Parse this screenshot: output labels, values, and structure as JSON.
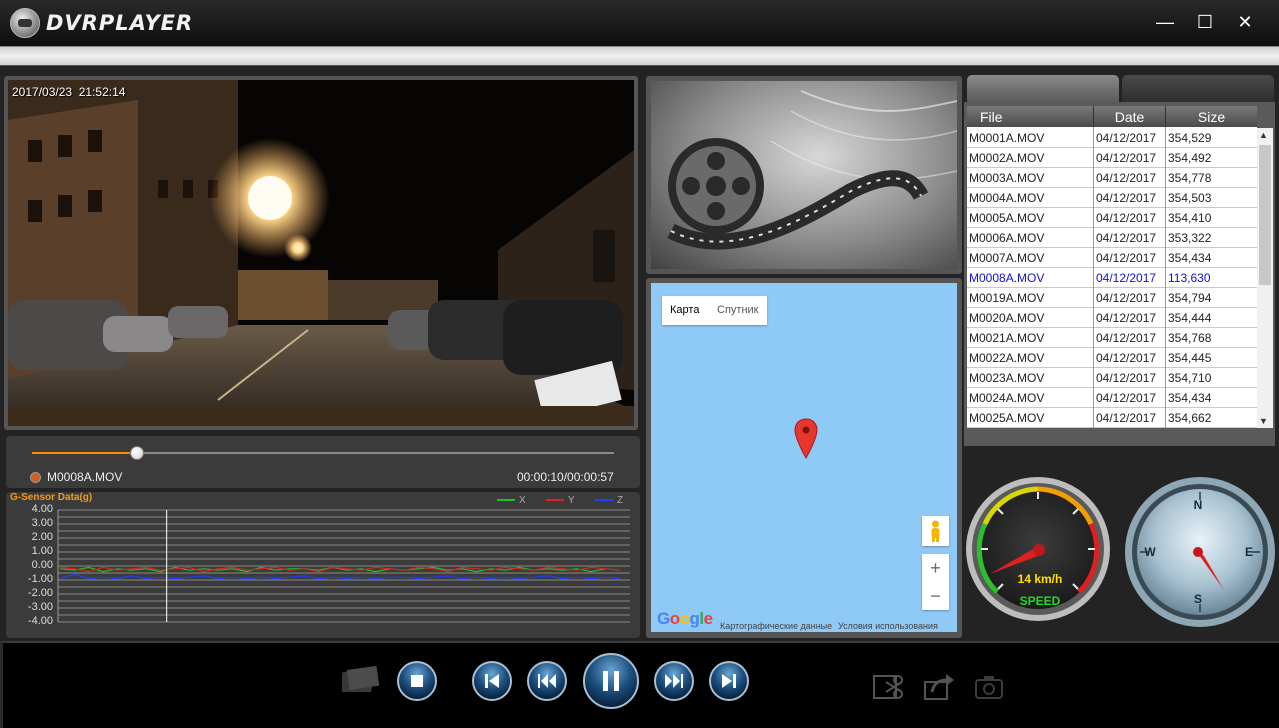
{
  "titlebar": {
    "app_title": "DVRPLAYER",
    "minimize": "—",
    "maximize": "☐",
    "close": "✕"
  },
  "video": {
    "date": "2017/03/23",
    "time": "21:52:14"
  },
  "timeline": {
    "current_file": "M0008A.MOV",
    "elapsed": "00:00:10",
    "duration": "00:00:57",
    "time_readout": "00:00:10/00:00:57",
    "progress": 0.18
  },
  "gsensor": {
    "chart_data": {
      "type": "line",
      "title": "G-Sensor Data(g)",
      "ylim": [
        -4.0,
        4.0
      ],
      "y_ticks": [
        "4.00",
        "3.00",
        "2.00",
        "1.00",
        "0.00",
        "-1.00",
        "-2.00",
        "-3.00",
        "-4.00"
      ],
      "grid": true,
      "legend_position": "top-right",
      "cursor_position": 0.19,
      "series": [
        {
          "name": "X",
          "color": "#1fc21f",
          "values": [
            -0.2,
            -0.3,
            -0.1,
            -0.4,
            -0.2,
            -0.3,
            -0.2,
            -0.4,
            -0.1,
            -0.3,
            -0.2,
            -0.3,
            -0.2,
            -0.4,
            -0.1,
            -0.3,
            -0.2,
            -0.2,
            -0.3,
            -0.1,
            -0.3,
            -0.2,
            -0.4,
            -0.2,
            -0.3,
            -0.2,
            -0.1,
            -0.3,
            -0.2,
            -0.4,
            -0.2,
            -0.3,
            -0.1,
            -0.3,
            -0.2,
            -0.3,
            -0.2,
            -0.4,
            -0.2,
            -0.3
          ]
        },
        {
          "name": "Y",
          "color": "#e02020",
          "values": [
            -0.1,
            -0.2,
            -0.4,
            -0.1,
            -0.3,
            -0.2,
            -0.1,
            -0.3,
            -0.2,
            -0.1,
            -0.4,
            -0.2,
            -0.1,
            -0.3,
            -0.2,
            -0.1,
            -0.3,
            -0.2,
            -0.4,
            -0.1,
            -0.2,
            -0.3,
            -0.1,
            -0.2,
            -0.3,
            -0.1,
            -0.2,
            -0.4,
            -0.1,
            -0.2,
            -0.3,
            -0.1,
            -0.2,
            -0.3,
            -0.1,
            -0.2,
            -0.3,
            -0.1,
            -0.2,
            -0.3
          ]
        },
        {
          "name": "Z",
          "color": "#2040ff",
          "values": [
            -0.9,
            -0.6,
            -0.9,
            -0.8,
            -0.9,
            -0.7,
            -0.9,
            -0.8,
            -0.9,
            -0.8,
            -0.7,
            -0.9,
            -0.8,
            -0.9,
            -0.8,
            -0.9,
            -0.8,
            -0.7,
            -0.9,
            -0.8,
            -0.9,
            -0.8,
            -0.9,
            -0.8,
            -0.8,
            -0.9,
            -0.8,
            -0.7,
            -0.9,
            -0.8,
            -0.9,
            -0.8,
            -0.9,
            -0.8,
            -0.7,
            -0.9,
            -0.8,
            -0.9,
            -0.8,
            -0.9
          ]
        }
      ]
    }
  },
  "map": {
    "map_btn": "Карта",
    "satellite_btn": "Спутник",
    "zoom_in": "+",
    "zoom_out": "−",
    "map_data_text": "Картографические данные",
    "terms_text": "Условия использования"
  },
  "file_list": {
    "columns": [
      "File",
      "Date",
      "Size"
    ],
    "rows": [
      {
        "file": "M0001A.MOV",
        "date": "04/12/2017",
        "size": "354,529"
      },
      {
        "file": "M0002A.MOV",
        "date": "04/12/2017",
        "size": "354,492"
      },
      {
        "file": "M0003A.MOV",
        "date": "04/12/2017",
        "size": "354,778"
      },
      {
        "file": "M0004A.MOV",
        "date": "04/12/2017",
        "size": "354,503"
      },
      {
        "file": "M0005A.MOV",
        "date": "04/12/2017",
        "size": "354,410"
      },
      {
        "file": "M0006A.MOV",
        "date": "04/12/2017",
        "size": "353,322"
      },
      {
        "file": "M0007A.MOV",
        "date": "04/12/2017",
        "size": "354,434"
      },
      {
        "file": "M0008A.MOV",
        "date": "04/12/2017",
        "size": "113,630"
      },
      {
        "file": "M0019A.MOV",
        "date": "04/12/2017",
        "size": "354,794"
      },
      {
        "file": "M0020A.MOV",
        "date": "04/12/2017",
        "size": "354,444"
      },
      {
        "file": "M0021A.MOV",
        "date": "04/12/2017",
        "size": "354,768"
      },
      {
        "file": "M0022A.MOV",
        "date": "04/12/2017",
        "size": "354,445"
      },
      {
        "file": "M0023A.MOV",
        "date": "04/12/2017",
        "size": "354,710"
      },
      {
        "file": "M0024A.MOV",
        "date": "04/12/2017",
        "size": "354,434"
      },
      {
        "file": "M0025A.MOV",
        "date": "04/12/2017",
        "size": "354,662"
      }
    ],
    "active_index": 7
  },
  "speedometer": {
    "speed_text": "14 km/h",
    "label": "SPEED"
  },
  "compass": {
    "n": "N",
    "e": "E",
    "s": "S",
    "w": "W"
  }
}
